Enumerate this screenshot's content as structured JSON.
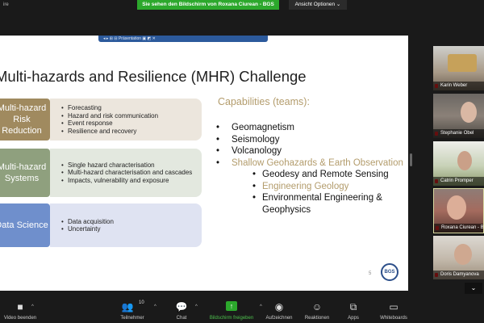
{
  "topbar": {
    "corner_text": "ire",
    "share_banner": "Sie sehen den Bildschirm von Roxana Ciurean - BGS",
    "view_options": "Ansicht Optionen ⌄"
  },
  "slide": {
    "toolbar_text": "◂ ▸ ⊞ ⊟      Präsentation      ▣ ◩ ✕",
    "title": "Multi-hazards and Resilience (MHR) Challenge",
    "boxes": [
      {
        "label": "Multi-hazard Risk Reduction",
        "items": [
          "Forecasting",
          "Hazard and risk communication",
          "Event response",
          "Resilience and recovery"
        ]
      },
      {
        "label": "Multi-hazard Systems",
        "items": [
          "Single hazard characterisation",
          "Multi-hazard characterisation and cascades",
          "Impacts, vulnerability and exposure"
        ]
      },
      {
        "label": "Data Science",
        "items": [
          "Data acquisition",
          "Uncertainty"
        ]
      }
    ],
    "capabilities_title": "Capabilities (teams):",
    "capabilities": [
      {
        "text": "Geomagnetism"
      },
      {
        "text": "Seismology"
      },
      {
        "text": "Volcanology"
      },
      {
        "text": "Shallow Geohazards & Earth Observation"
      },
      {
        "text": "Geodesy and Remote Sensing"
      },
      {
        "text": "Engineering Geology"
      },
      {
        "text": "Environmental Engineering & Geophysics"
      }
    ],
    "slide_number": "5",
    "logo_text": "BGS"
  },
  "participants": [
    {
      "name": "Karin Weber"
    },
    {
      "name": "Stephanie Obel"
    },
    {
      "name": "Catrin Promper"
    },
    {
      "name": "Roxana Ciurean - B"
    },
    {
      "name": "Doris Damyanova"
    }
  ],
  "collapse_icon": "⌄",
  "toolbar": {
    "video_label": "Video beenden",
    "participants_label": "Teilnehmer",
    "participants_count": "10",
    "chat_label": "Chat",
    "share_label": "Bildschirm freigeben",
    "record_label": "Aufzeichnen",
    "reactions_label": "Reaktionen",
    "apps_label": "Apps",
    "whiteboards_label": "Whiteboards"
  },
  "colors": {
    "share_green": "#2ca82c",
    "box1": "#a08a5f",
    "box2": "#8fa07e",
    "box3": "#6f8fcc",
    "capability_tan": "#b39c6c"
  }
}
